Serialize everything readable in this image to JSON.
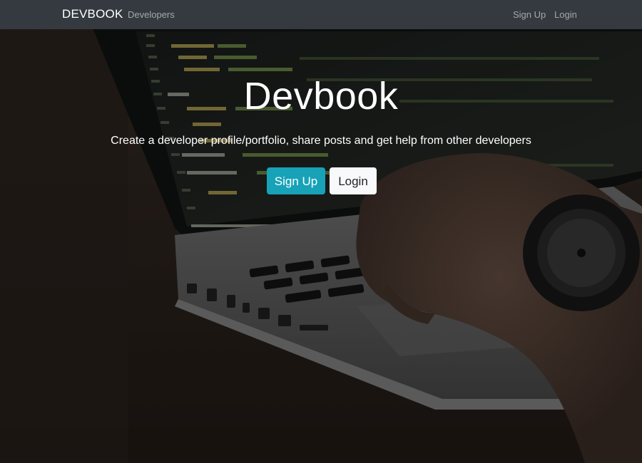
{
  "navbar": {
    "brand": "DEVBOOK",
    "links": {
      "developers": "Developers",
      "signup": "Sign Up",
      "login": "Login"
    }
  },
  "hero": {
    "title": "Devbook",
    "lead": "Create a developer profile/portfolio, share posts and get help from other developers",
    "buttons": {
      "signup": "Sign Up",
      "login": "Login"
    }
  },
  "colors": {
    "navbar_bg": "#343a40",
    "signup_button": "#17a2b8",
    "login_button": "#f8f9fa",
    "text": "#ffffff"
  },
  "background": {
    "scene": "laptop-with-code-editor-and-hand-on-keyboard"
  }
}
